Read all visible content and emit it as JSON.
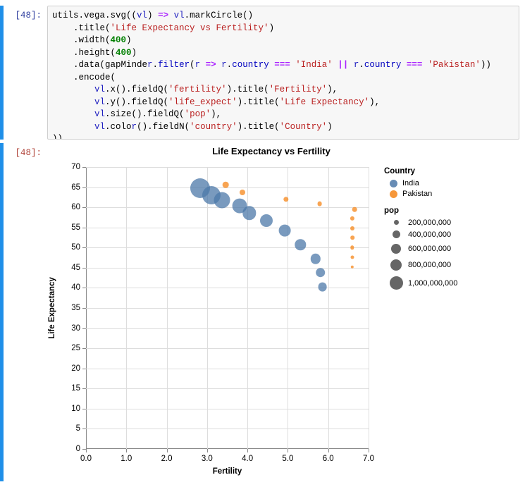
{
  "notebook": {
    "input_prompt": "[48]:",
    "output_prompt": "[48]:",
    "code_lines": [
      "utils.vega.svg((vl) => vl.markCircle()",
      "    .title('Life Expectancy vs Fertility')",
      "    .width(400)",
      "    .height(400)",
      "    .data(gapMinder.filter(r => r.country === 'India' || r.country === 'Pakistan'))",
      "    .encode(",
      "        vl.x().fieldQ('fertility').title('Fertility'),",
      "        vl.y().fieldQ('life_expect').title('Life Expectancy'),",
      "        vl.size().fieldQ('pop'),",
      "        vl.color().fieldN('country').title('Country')",
      "))"
    ]
  },
  "colors": {
    "india": "#4c78a8",
    "pakistan": "#f58518",
    "legend_size_dot": "#666666",
    "gridline": "#dddddd",
    "axis": "#888888",
    "selection_bar": "#1f8fe8",
    "code_bg": "#f7f7f7"
  },
  "chart_data": {
    "type": "scatter",
    "title": "Life Expectancy vs Fertility",
    "xlabel": "Fertility",
    "ylabel": "Life Expectancy",
    "xlim": [
      0,
      7
    ],
    "ylim": [
      0,
      70
    ],
    "xticks": [
      "0.0",
      "1.0",
      "2.0",
      "3.0",
      "4.0",
      "5.0",
      "6.0",
      "7.0"
    ],
    "xtick_values": [
      0,
      1,
      2,
      3,
      4,
      5,
      6,
      7
    ],
    "yticks": [
      "0",
      "5",
      "10",
      "15",
      "20",
      "25",
      "30",
      "35",
      "40",
      "45",
      "50",
      "55",
      "60",
      "65",
      "70"
    ],
    "ytick_values": [
      0,
      5,
      10,
      15,
      20,
      25,
      30,
      35,
      40,
      45,
      50,
      55,
      60,
      65,
      70
    ],
    "grid": true,
    "legend_position": "right",
    "size_field": "pop",
    "size_legend_title": "pop",
    "size_legend_values": [
      200000000,
      400000000,
      600000000,
      800000000,
      1000000000
    ],
    "size_legend_labels": [
      "200,000,000",
      "400,000,000",
      "600,000,000",
      "800,000,000",
      "1,000,000,000"
    ],
    "size_legend_radii": [
      3.5,
      5.5,
      7.0,
      8.2,
      9.5
    ],
    "color_legend_title": "Country",
    "series": [
      {
        "name": "India",
        "color": "#4c78a8",
        "points": [
          {
            "x": 2.82,
            "y": 64.7,
            "r": 14.0,
            "pop": 1056575549
          },
          {
            "x": 3.11,
            "y": 63.0,
            "r": 13.0,
            "pop": 929339191
          },
          {
            "x": 3.37,
            "y": 61.8,
            "r": 11.5,
            "pop": 849838000
          },
          {
            "x": 3.81,
            "y": 60.3,
            "r": 10.4,
            "pop": 781983000
          },
          {
            "x": 4.05,
            "y": 58.6,
            "r": 9.7,
            "pop": 708000000
          },
          {
            "x": 4.47,
            "y": 56.7,
            "r": 9.0,
            "pop": 634000000
          },
          {
            "x": 4.93,
            "y": 54.3,
            "r": 8.4,
            "pop": 565000000
          },
          {
            "x": 5.31,
            "y": 50.7,
            "r": 7.7,
            "pop": 506000000
          },
          {
            "x": 5.69,
            "y": 47.2,
            "r": 7.2,
            "pop": 455000000
          },
          {
            "x": 5.81,
            "y": 43.8,
            "r": 6.8,
            "pop": 409880595
          },
          {
            "x": 5.86,
            "y": 40.3,
            "r": 6.4,
            "pop": 372000000
          }
        ]
      },
      {
        "name": "Pakistan",
        "color": "#f58518",
        "points": [
          {
            "x": 3.46,
            "y": 65.6,
            "r": 4.3,
            "pop": 162000000
          },
          {
            "x": 3.87,
            "y": 63.7,
            "r": 4.0,
            "pop": 138000000
          },
          {
            "x": 4.95,
            "y": 62.0,
            "r": 3.7,
            "pop": 115000000
          },
          {
            "x": 5.79,
            "y": 60.9,
            "r": 3.4,
            "pop": 93000000
          },
          {
            "x": 6.65,
            "y": 59.5,
            "r": 3.3,
            "pop": 78000000
          },
          {
            "x": 6.6,
            "y": 57.2,
            "r": 3.1,
            "pop": 65000000
          },
          {
            "x": 6.6,
            "y": 54.8,
            "r": 3.0,
            "pop": 58000000
          },
          {
            "x": 6.6,
            "y": 52.5,
            "r": 2.8,
            "pop": 50000000
          },
          {
            "x": 6.6,
            "y": 50.0,
            "r": 2.7,
            "pop": 45000000
          },
          {
            "x": 6.6,
            "y": 47.6,
            "r": 2.5,
            "pop": 41000000
          },
          {
            "x": 6.6,
            "y": 45.2,
            "r": 2.2,
            "pop": 37000000
          }
        ]
      }
    ]
  }
}
